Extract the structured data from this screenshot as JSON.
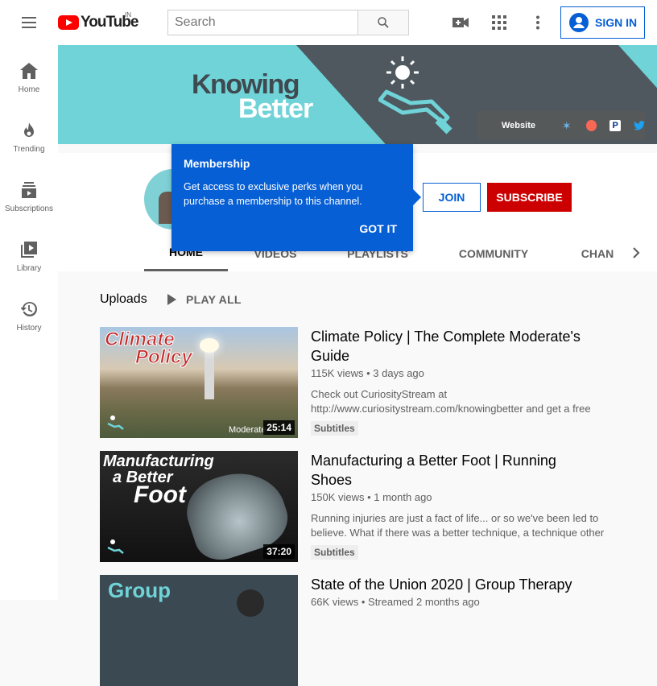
{
  "header": {
    "logo_text": "YouTube",
    "country": "IN",
    "search_placeholder": "Search",
    "sign_in_label": "SIGN IN"
  },
  "sidenav": {
    "items": [
      {
        "label": "Home",
        "icon": "home-icon"
      },
      {
        "label": "Trending",
        "icon": "fire-icon"
      },
      {
        "label": "Subscriptions",
        "icon": "subscriptions-icon"
      },
      {
        "label": "Library",
        "icon": "library-icon"
      },
      {
        "label": "History",
        "icon": "history-icon"
      }
    ]
  },
  "banner": {
    "title_line1": "Knowing",
    "title_line2": "Better",
    "website_label": "Website"
  },
  "channel": {
    "join_label": "JOIN",
    "subscribe_label": "SUBSCRIBE"
  },
  "tooltip": {
    "title": "Membership",
    "body": "Get access to exclusive perks when you purchase a membership to this channel.",
    "got_it": "GOT IT"
  },
  "tabs": [
    {
      "label": "HOME",
      "active": true
    },
    {
      "label": "VIDEOS"
    },
    {
      "label": "PLAYLISTS"
    },
    {
      "label": "COMMUNITY"
    },
    {
      "label": "CHAN"
    }
  ],
  "uploads": {
    "title": "Uploads",
    "play_all": "PLAY ALL",
    "videos": [
      {
        "title": "Climate Policy | The Complete Moderate's Guide",
        "meta": "115K views • 3 days ago",
        "description": "Check out CuriosityStream at http://www.curiositystream.com/knowingbetter and get a free",
        "badge": "Subtitles",
        "duration": "25:14",
        "thumb_text1": "Climate",
        "thumb_text2": "Policy",
        "thumb_corner": "Moderate"
      },
      {
        "title": "Manufacturing a Better Foot | Running Shoes",
        "meta": "150K views • 1 month ago",
        "description": "Running injuries are just a fact of life... or so we've been led to believe. What if there was a better technique, a technique other",
        "badge": "Subtitles",
        "duration": "37:20",
        "thumb_text1": "Manufacturing",
        "thumb_text2": "a Better",
        "thumb_text3": "Foot"
      },
      {
        "title": "State of the Union 2020 | Group Therapy",
        "meta": "66K views • Streamed 2 months ago",
        "thumb_text1": "Group"
      }
    ]
  }
}
